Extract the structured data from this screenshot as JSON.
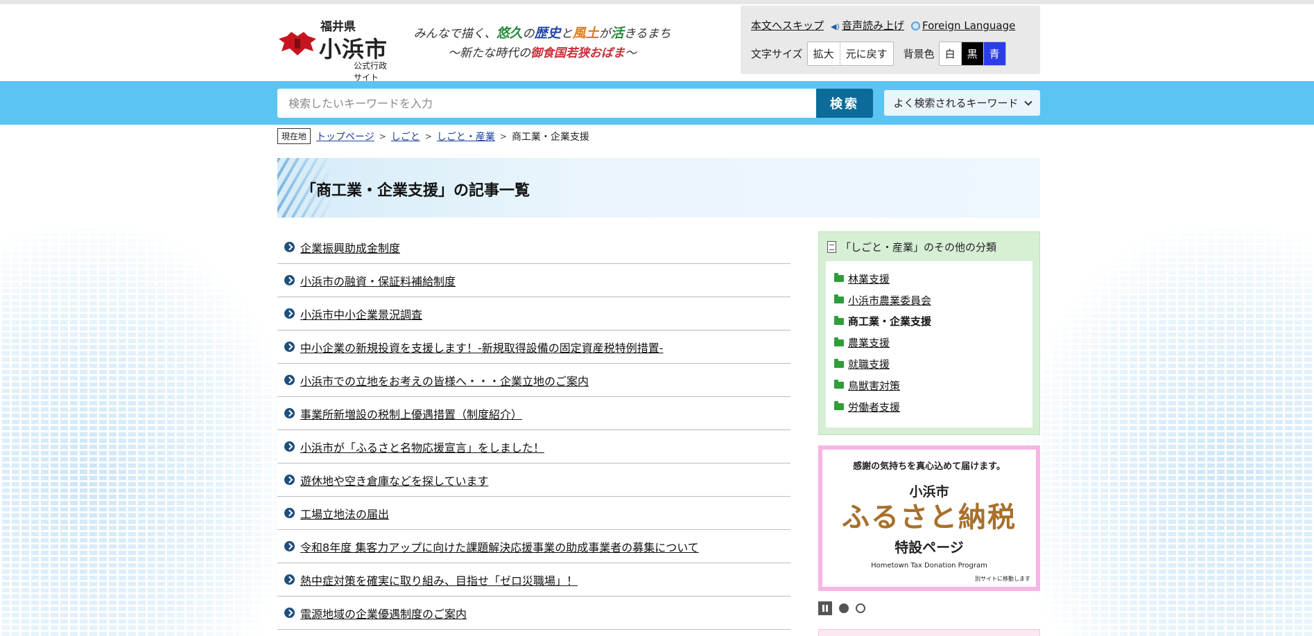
{
  "header": {
    "logo": {
      "prefecture": "福井県",
      "city": "小浜市",
      "subtitle": "公式行政サイト"
    },
    "tagline": {
      "line1": [
        "みんなで",
        "描く",
        "、",
        "悠久",
        "の",
        "歴史",
        "と",
        "風土",
        "が",
        "活",
        "きるまち"
      ],
      "line2_pre": "～新たな時代の",
      "line2_em": "御食国若狭おばま",
      "line2_post": "～"
    },
    "util": {
      "skip_label": "本文へスキップ",
      "speech_label": "音声読み上げ",
      "foreign_label": "Foreign Language",
      "text_size_label": "文字サイズ",
      "enlarge_label": "拡大",
      "reset_label": "元に戻す",
      "bg_color_label": "背景色",
      "bg_white": "白",
      "bg_black": "黒",
      "bg_blue": "青"
    }
  },
  "search": {
    "placeholder": "検索したいキーワードを入力",
    "button_label": "検索",
    "keywords_label": "よく検索されるキーワード"
  },
  "breadcrumb": {
    "here_label": "現在地",
    "items": [
      "トップページ",
      "しごと",
      "しごと・産業"
    ],
    "current": "商工業・企業支援"
  },
  "page_title": "「商工業・企業支援」の記事一覧",
  "articles": [
    "企業振興助成金制度",
    "小浜市の融資・保証料補給制度",
    "小浜市中小企業景況調査",
    "中小企業の新規投資を支援します！-新規取得設備の固定資産税特例措置-",
    "小浜市での立地をお考えの皆様へ・・・企業立地のご案内",
    "事業所新増設の税制上優遇措置（制度紹介）",
    "小浜市が「ふるさと名物応援宣言」をしました！",
    "遊休地や空き倉庫などを探しています",
    "工場立地法の届出",
    "令和8年度 集客力アップに向けた課題解決応援事業の助成事業者の募集について",
    "熱中症対策を確実に取り組み、目指せ「ゼロ災職場」！",
    "電源地域の企業優遇制度のご案内"
  ],
  "sidebar": {
    "heading": "「しごと・産業」のその他の分類",
    "items": [
      {
        "label": "林業支援",
        "current": false
      },
      {
        "label": "小浜市農業委員会",
        "current": false
      },
      {
        "label": "商工業・企業支援",
        "current": true
      },
      {
        "label": "農業支援",
        "current": false
      },
      {
        "label": "就職支援",
        "current": false
      },
      {
        "label": "鳥獣害対策",
        "current": false
      },
      {
        "label": "労働者支援",
        "current": false
      }
    ]
  },
  "banner": {
    "line1": "感謝の気持ちを真心込めて届けます。",
    "line2": "小浜市",
    "line3": "ふるさと納税",
    "line4": "特設ページ",
    "line5": "Hometown Tax Donation Program",
    "line6": "別サイトに移動します"
  },
  "colors": {
    "search_bar": "#5cc4f2",
    "search_button": "#0c6b99",
    "sidebar_bg": "#d7efd5",
    "banner_border": "#f6b5e4",
    "banner_accent": "#a8702c"
  }
}
